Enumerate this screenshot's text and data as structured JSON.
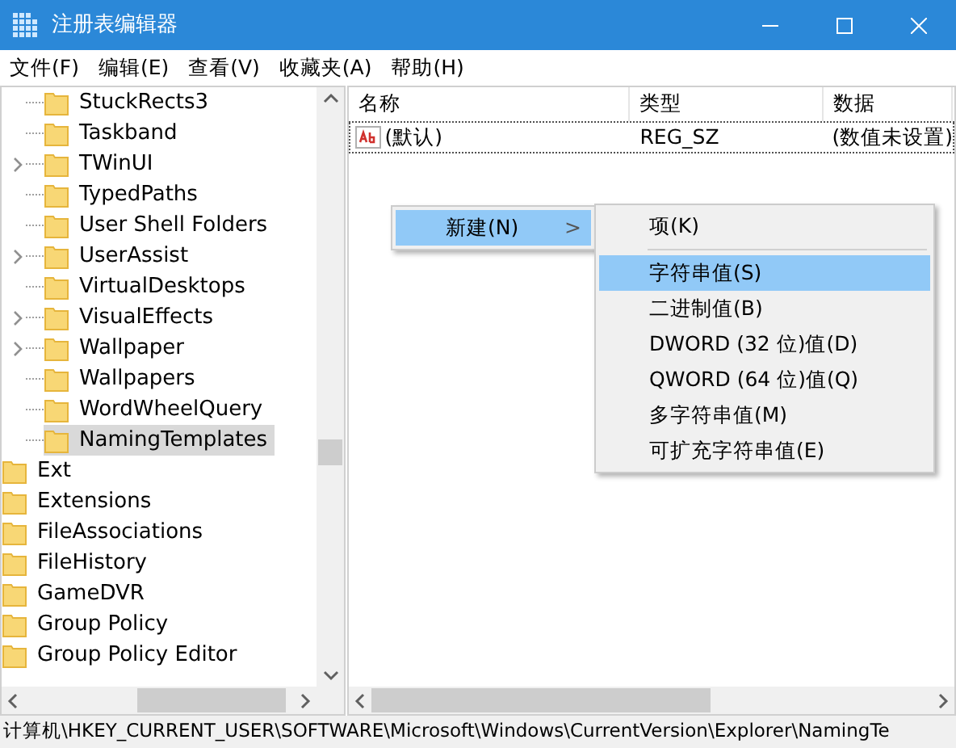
{
  "window": {
    "title": "注册表编辑器"
  },
  "menu": [
    "文件(F)",
    "编辑(E)",
    "查看(V)",
    "收藏夹(A)",
    "帮助(H)"
  ],
  "tree": [
    {
      "children": [
        {
          "label": "StuckRects3",
          "expandable": false,
          "selected": false
        },
        {
          "label": "Taskband",
          "expandable": false,
          "selected": false
        },
        {
          "label": "TWinUI",
          "expandable": true,
          "selected": false
        },
        {
          "label": "TypedPaths",
          "expandable": false,
          "selected": false
        },
        {
          "label": "User Shell Folders",
          "expandable": false,
          "selected": false
        },
        {
          "label": "UserAssist",
          "expandable": true,
          "selected": false
        },
        {
          "label": "VirtualDesktops",
          "expandable": false,
          "selected": false
        },
        {
          "label": "VisualEffects",
          "expandable": true,
          "selected": false
        },
        {
          "label": "Wallpaper",
          "expandable": true,
          "selected": false
        },
        {
          "label": "Wallpapers",
          "expandable": false,
          "selected": false
        },
        {
          "label": "WordWheelQuery",
          "expandable": false,
          "selected": false
        },
        {
          "label": "NamingTemplates",
          "expandable": false,
          "selected": true
        }
      ]
    },
    {
      "label": "Ext",
      "selected": false
    },
    {
      "label": "Extensions",
      "selected": false
    },
    {
      "label": "FileAssociations",
      "selected": false
    },
    {
      "label": "FileHistory",
      "selected": false
    },
    {
      "label": "GameDVR",
      "selected": false
    },
    {
      "label": "Group Policy",
      "selected": false
    },
    {
      "label": "Group Policy Editor",
      "selected": false
    }
  ],
  "table": {
    "columns": [
      "名称",
      "类型",
      "数据"
    ],
    "rows": [
      {
        "name": "(默认)",
        "type": "REG_SZ",
        "data": "(数值未设置)"
      }
    ]
  },
  "context_menu": {
    "label": "新建(N)",
    "arrow": ">",
    "selected": true
  },
  "submenu": [
    {
      "label": "项(K)",
      "selected": false,
      "kind": "item"
    },
    {
      "kind": "separator"
    },
    {
      "label": "字符串值(S)",
      "selected": true,
      "kind": "item"
    },
    {
      "label": "二进制值(B)",
      "selected": false,
      "kind": "item"
    },
    {
      "label": "DWORD (32 位)值(D)",
      "selected": false,
      "kind": "item"
    },
    {
      "label": "QWORD (64 位)值(Q)",
      "selected": false,
      "kind": "item"
    },
    {
      "label": "多字符串值(M)",
      "selected": false,
      "kind": "item"
    },
    {
      "label": "可扩充字符串值(E)",
      "selected": false,
      "kind": "item"
    }
  ],
  "status_bar": "计算机\\HKEY_CURRENT_USER\\SOFTWARE\\Microsoft\\Windows\\CurrentVersion\\Explorer\\NamingTe"
}
